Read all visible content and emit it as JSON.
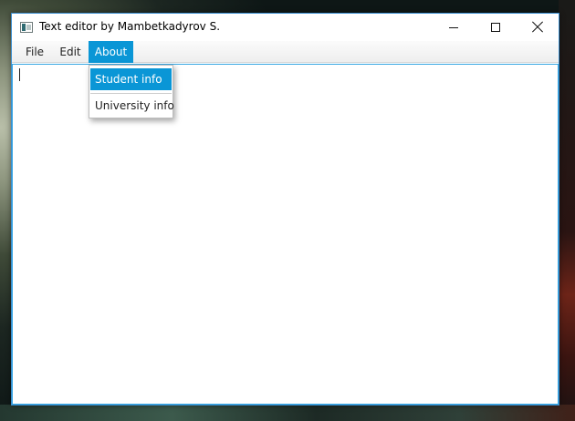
{
  "window": {
    "title": "Text editor by Mambetkadyrov S."
  },
  "menubar": {
    "items": [
      {
        "label": "File"
      },
      {
        "label": "Edit"
      },
      {
        "label": "About"
      }
    ],
    "active": "About"
  },
  "about_menu": {
    "items": [
      {
        "label": "Student info",
        "highlighted": true
      },
      {
        "label": "University info",
        "highlighted": false
      }
    ]
  },
  "editor": {
    "text": ""
  },
  "colors": {
    "accent": "#0a96d6",
    "window_border": "#3b8fd0",
    "editor_focus_border": "#36a6e2"
  },
  "icons": {
    "app": "app-window-icon",
    "minimize": "minimize-icon",
    "maximize": "maximize-icon",
    "close": "close-icon"
  }
}
